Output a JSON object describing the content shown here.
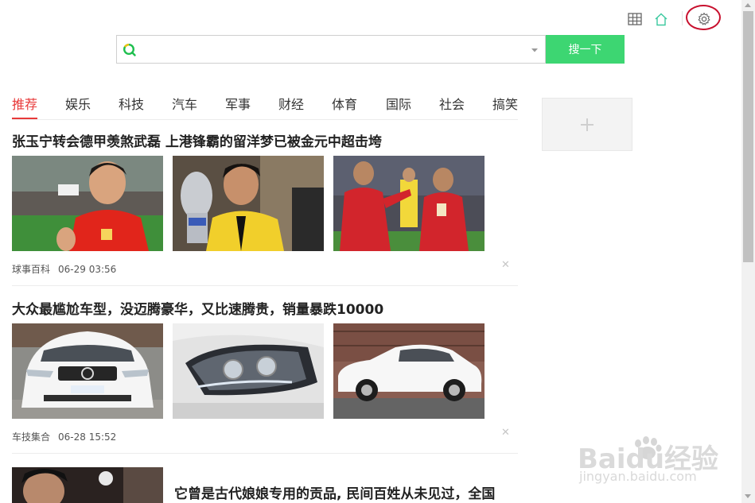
{
  "toolbar": {
    "icons": [
      "grid-icon",
      "home-icon",
      "settings-icon"
    ],
    "settings_highlight_color": "#c8102e"
  },
  "search": {
    "value": "",
    "button_label": "搜一下",
    "button_color": "#3dd672"
  },
  "tabs": [
    {
      "label": "推荐",
      "active": true
    },
    {
      "label": "娱乐"
    },
    {
      "label": "科技"
    },
    {
      "label": "汽车"
    },
    {
      "label": "军事"
    },
    {
      "label": "财经"
    },
    {
      "label": "体育"
    },
    {
      "label": "国际"
    },
    {
      "label": "社会"
    },
    {
      "label": "搞笑"
    }
  ],
  "accent_color": "#e83a3a",
  "news": [
    {
      "title": "张玉宁转会德甲羡煞武磊 上港锋霸的留洋梦已被金元中超击垮",
      "source": "球事百科",
      "time": "06-29 03:56",
      "images": [
        "soccer-player-photo",
        "soccer-trophy-photo",
        "soccer-celebration-photo"
      ]
    },
    {
      "title": "大众最尴尬车型，没迈腾豪华，又比速腾贵，销量暴跌10000",
      "source": "车技集合",
      "time": "06-28 15:52",
      "images": [
        "car-front-photo",
        "car-headlight-photo",
        "car-side-photo"
      ]
    },
    {
      "title": "它曾是古代娘娘专用的贡品, 民间百姓从未见过，全国",
      "images": [
        "man-portrait-photo"
      ]
    }
  ],
  "watermark": {
    "brand": "Baidu经验",
    "url": "jingyan.baidu.com"
  }
}
